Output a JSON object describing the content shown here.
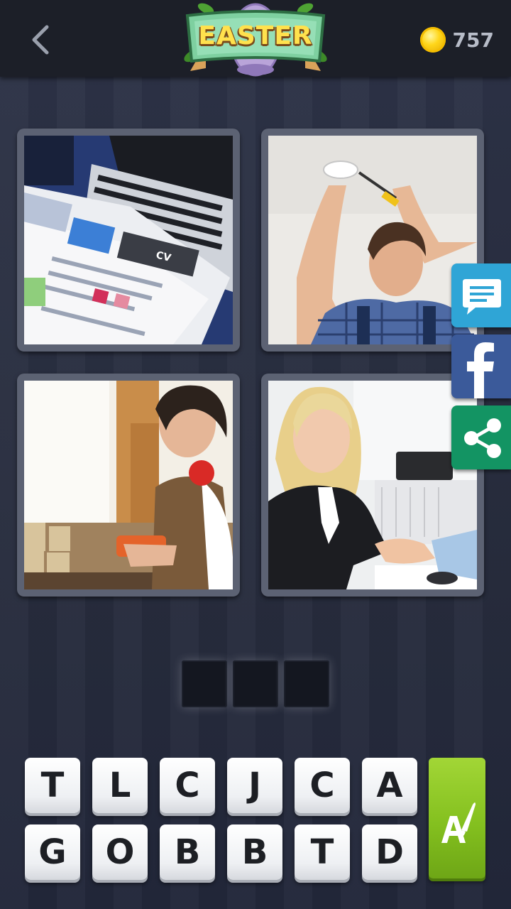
{
  "header": {
    "badge_title": "EASTER",
    "coins": "757"
  },
  "tiles": [
    {
      "name": "resume-laptop-photo",
      "label": "CV"
    },
    {
      "name": "electrician-smoke-detector-photo"
    },
    {
      "name": "carpenter-woodwork-photo"
    },
    {
      "name": "business-handshake-photo"
    }
  ],
  "answer": {
    "slots": [
      "",
      "",
      ""
    ]
  },
  "keys": {
    "row1": [
      "T",
      "L",
      "C",
      "J",
      "C",
      "A"
    ],
    "row2": [
      "G",
      "O",
      "B",
      "B",
      "T",
      "D"
    ]
  },
  "icons": {
    "back": "chevron-left-icon",
    "coin": "coin-icon",
    "hint": "paintbrush-letter-icon",
    "chat": "chat-bubble-icon",
    "facebook": "facebook-icon",
    "share": "share-icon"
  },
  "colors": {
    "chat": "#2fa5d6",
    "facebook": "#3b5a9a",
    "share": "#139463",
    "hint": "#84c01f",
    "coin": "#ffd61a"
  }
}
